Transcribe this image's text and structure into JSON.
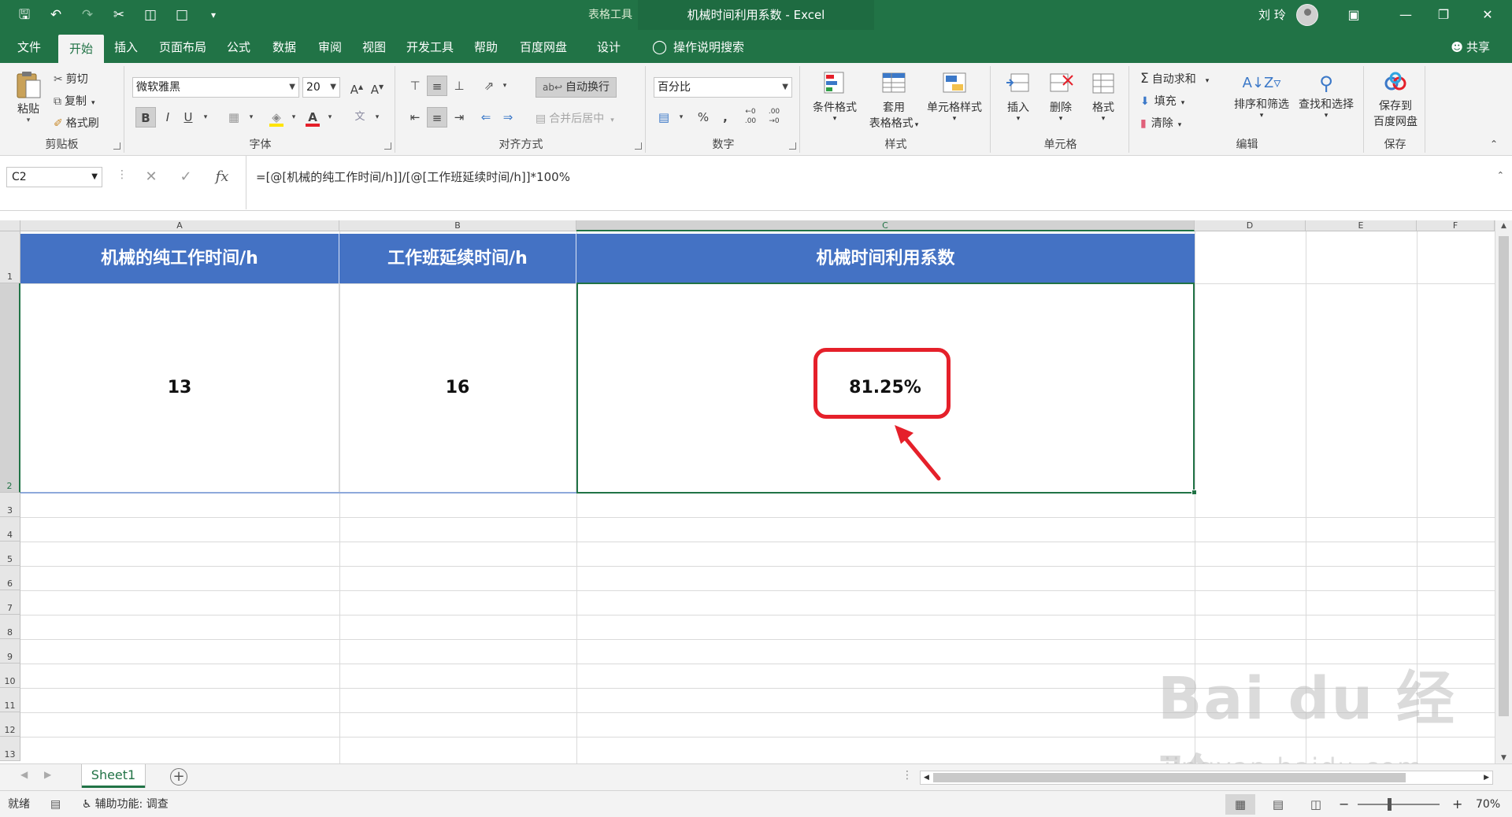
{
  "titlebar": {
    "context_tools": "表格工具",
    "doc_title": "机械时间利用系数 - Excel",
    "user": "刘 玲",
    "colors": {
      "excel_green": "#217346"
    }
  },
  "tabs": [
    {
      "label": "文件"
    },
    {
      "label": "开始",
      "active": true
    },
    {
      "label": "插入"
    },
    {
      "label": "页面布局"
    },
    {
      "label": "公式"
    },
    {
      "label": "数据"
    },
    {
      "label": "审阅"
    },
    {
      "label": "视图"
    },
    {
      "label": "开发工具"
    },
    {
      "label": "帮助"
    },
    {
      "label": "百度网盘"
    },
    {
      "label": "设计"
    }
  ],
  "tell_me": "操作说明搜索",
  "share": "共享",
  "ribbon": {
    "clipboard": {
      "label": "剪贴板",
      "paste": "粘贴",
      "cut": "剪切",
      "copy": "复制",
      "format_painter": "格式刷"
    },
    "font": {
      "label": "字体",
      "name": "微软雅黑",
      "size": "20"
    },
    "alignment": {
      "label": "对齐方式",
      "wrap": "自动换行",
      "merge": "合并后居中"
    },
    "number": {
      "label": "数字",
      "format": "百分比"
    },
    "styles": {
      "label": "样式",
      "conditional": "条件格式",
      "table_line1": "套用",
      "table_line2": "表格格式",
      "cell_styles": "单元格样式"
    },
    "cells": {
      "label": "单元格",
      "insert": "插入",
      "delete": "删除",
      "format": "格式"
    },
    "editing": {
      "label": "编辑",
      "autosum": "自动求和",
      "fill": "填充",
      "clear": "清除",
      "sort": "排序和筛选",
      "find": "查找和选择"
    },
    "save": {
      "label": "保存",
      "line1": "保存到",
      "line2": "百度网盘"
    }
  },
  "formula_bar": {
    "name_box": "C2",
    "formula": "=[@[机械的纯工作时间/h]]/[@[工作班延续时间/h]]*100%"
  },
  "columns": [
    "A",
    "B",
    "C",
    "D",
    "E",
    "F"
  ],
  "rows": [
    "1",
    "2",
    "3",
    "4",
    "5",
    "6",
    "7",
    "8",
    "9",
    "10",
    "11",
    "12",
    "13"
  ],
  "table": {
    "headers": [
      "机械的纯工作时间/h",
      "工作班延续时间/h",
      "机械时间利用系数"
    ],
    "values": [
      "13",
      "16",
      "81.25%"
    ],
    "colors": {
      "header_fill": "#4472c4",
      "annotation": "#e5202a"
    }
  },
  "sheets": [
    {
      "name": "Sheet1",
      "active": true
    }
  ],
  "status": {
    "ready": "就绪",
    "accessibility": "辅助功能: 调查",
    "zoom": "70%"
  },
  "watermark": {
    "line1": "Bai du 经验",
    "line2": "jingyan.baidu.com"
  }
}
